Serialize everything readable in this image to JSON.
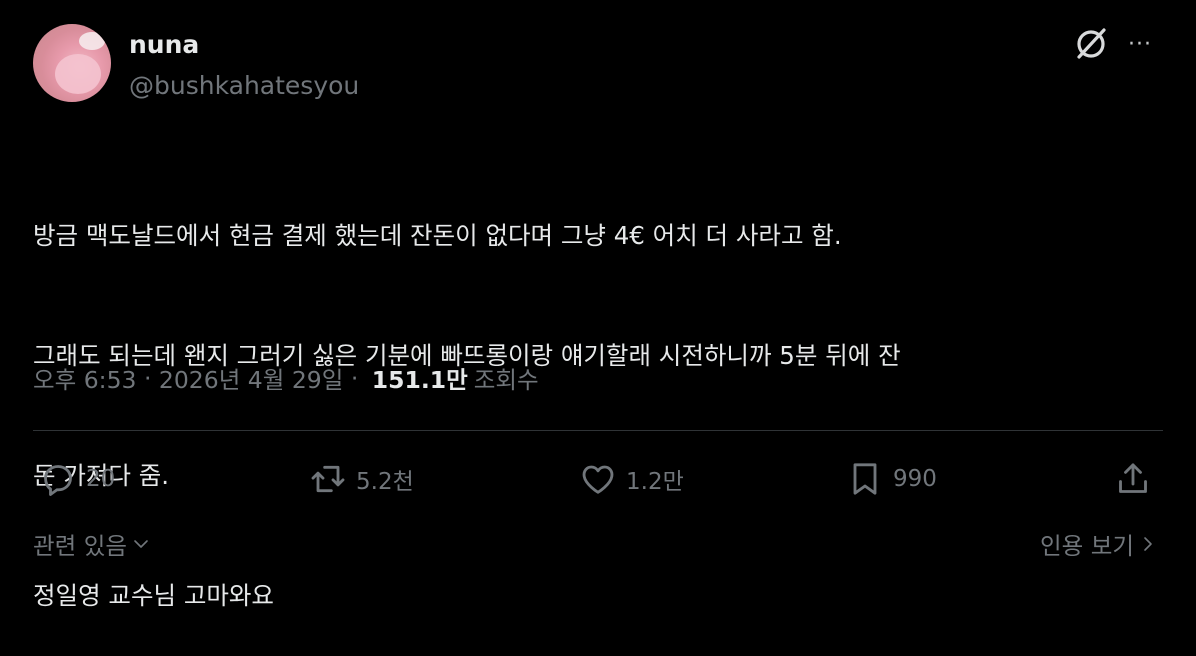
{
  "author": {
    "name": "nuna",
    "handle": "@bushkahatesyou"
  },
  "header_icons": {
    "grok": "grok-icon",
    "more": "···"
  },
  "tweet": {
    "lines": [
      "방금 맥도날드에서 현금 결제 했는데 잔돈이 없다며 그냥 4€ 어치 더 사라고 함.",
      "그래도 되는데 왠지 그러기 싫은 기분에 빠뜨롱이랑 얘기할래 시전하니까 5분 뒤에 잔",
      "돈 가져다 줌.",
      "정일영 교수님 고마와요"
    ]
  },
  "meta": {
    "time": "오후 6:53",
    "sep1": " · ",
    "date": "2026년 4월 29일",
    "sep2": " · ",
    "views_count": "151.1만",
    "views_label": "조회수"
  },
  "actions": {
    "reply": {
      "icon": "reply-icon",
      "count": "20"
    },
    "repost": {
      "icon": "repost-icon",
      "count": "5.2천"
    },
    "like": {
      "icon": "heart-icon",
      "count": "1.2만"
    },
    "bookmark": {
      "icon": "bookmark-icon",
      "count": "990"
    },
    "share": {
      "icon": "share-icon"
    }
  },
  "footer": {
    "related_label": "관련 있음",
    "quotes_label": "인용 보기"
  },
  "colors": {
    "background": "#000000",
    "text": "#e7e9ea",
    "secondary": "#71767b",
    "divider": "#2f3336"
  }
}
